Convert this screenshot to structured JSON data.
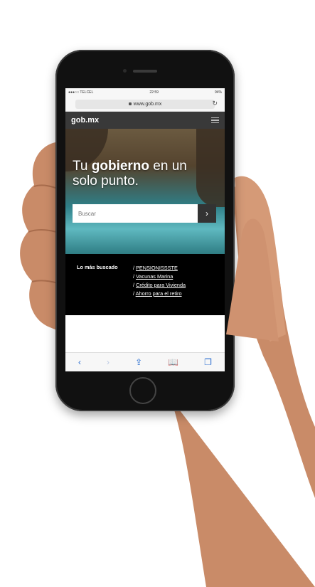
{
  "statusbar": {
    "carrier": "●●●○○ TELCEL",
    "time": "22:59",
    "battery": "94%"
  },
  "browser": {
    "url": "www.gob.mx",
    "reload_icon": "reload-icon"
  },
  "site": {
    "logo": "gob.mx",
    "menu_icon": "hamburger-menu-icon"
  },
  "hero": {
    "title_prefix": "Tu ",
    "title_bold": "gobierno",
    "title_suffix": " en un solo punto.",
    "search_placeholder": "Buscar",
    "search_button_icon": "chevron-right-icon",
    "search_button_glyph": "›"
  },
  "popular": {
    "label": "Lo más buscado",
    "links": [
      {
        "prefix": "/ ",
        "text": "PENSIONISSSTE"
      },
      {
        "prefix": "/ ",
        "text": "Vacunas Marina"
      },
      {
        "prefix": "/ ",
        "text": "Crédito para Vivienda"
      },
      {
        "prefix": "/ ",
        "text": "Ahorro para el retiro"
      }
    ]
  },
  "toolbar": {
    "back": "‹",
    "forward": "›",
    "share": "⇪",
    "bookmarks": "📖",
    "tabs": "❐"
  },
  "colors": {
    "header": "#393939",
    "accent": "#2c6fd1",
    "popular_bg": "#000000"
  }
}
